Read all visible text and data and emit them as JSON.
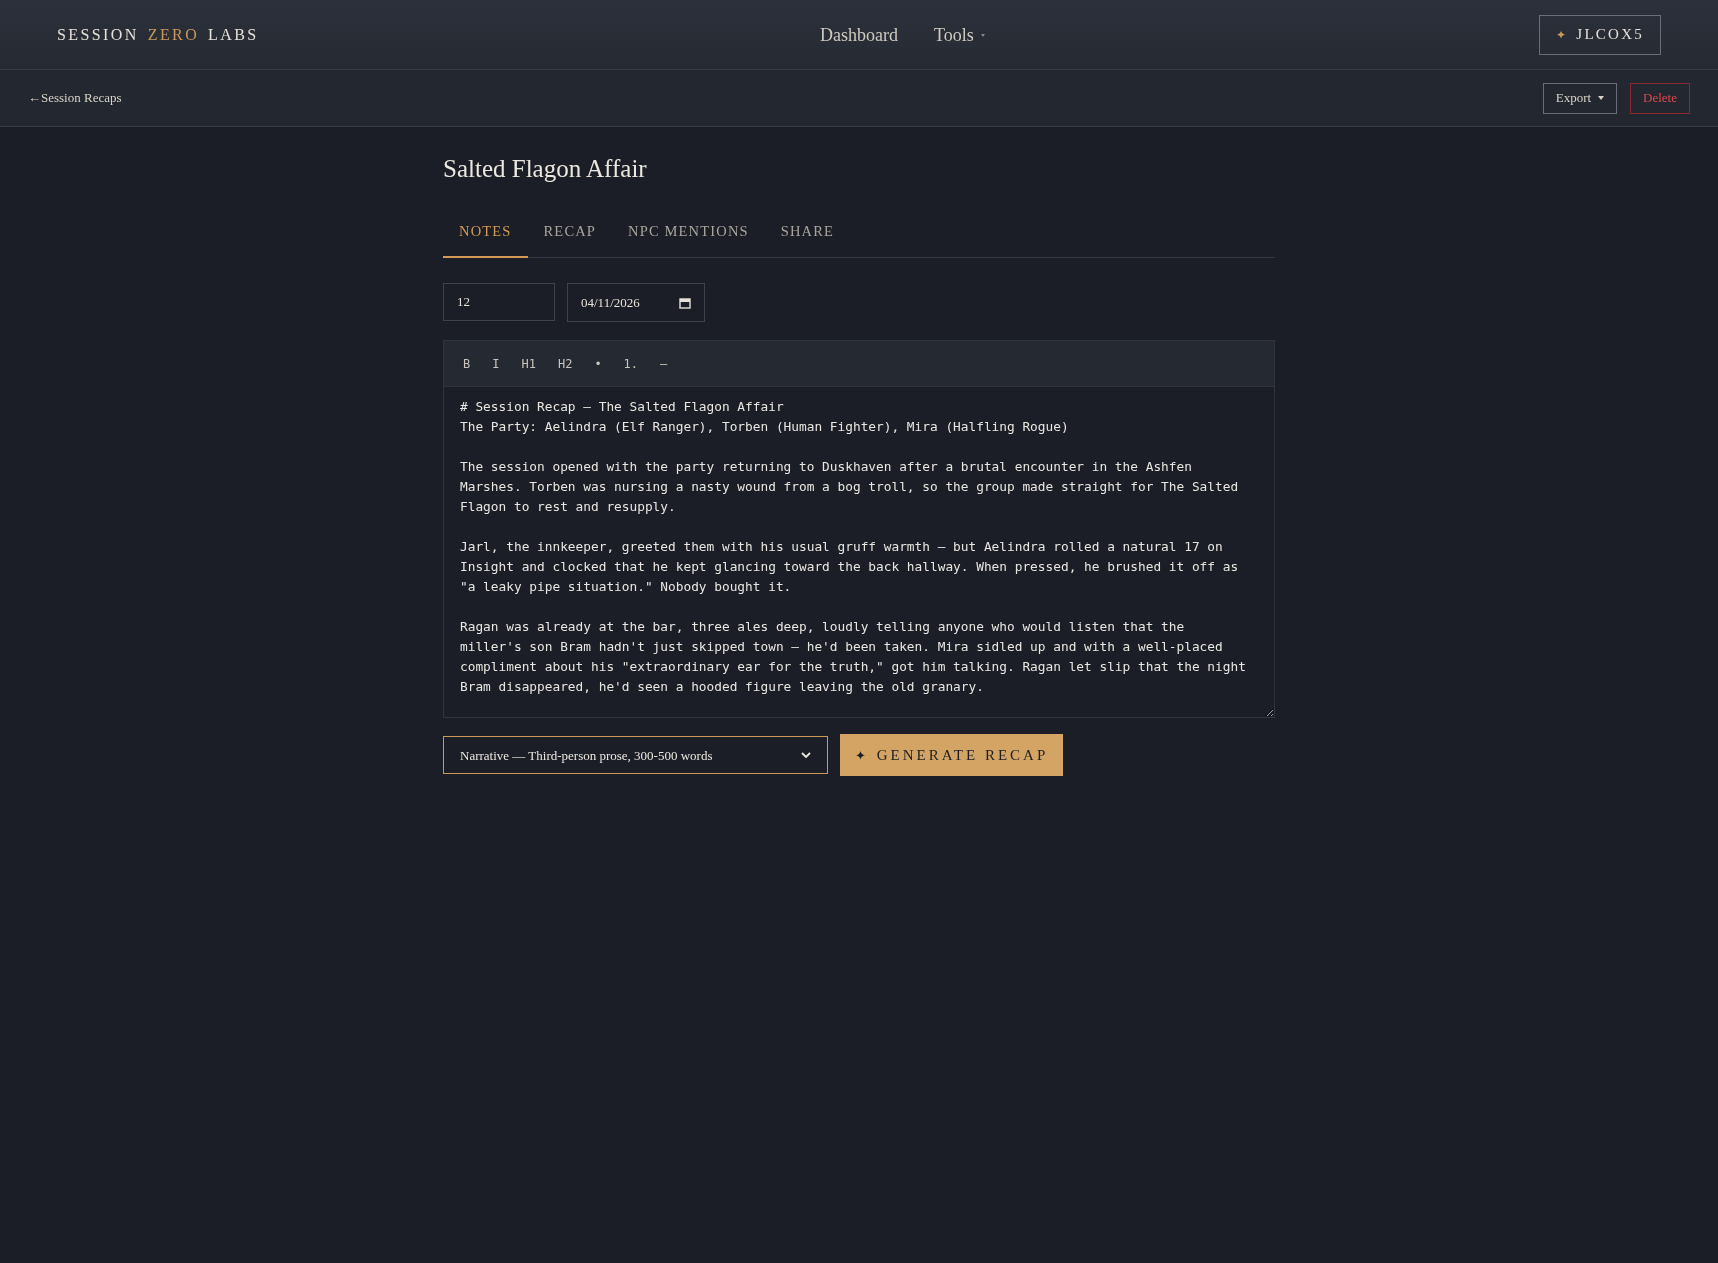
{
  "brand": {
    "parts": [
      {
        "text": "SESSION",
        "accent": false
      },
      {
        "text": "ZERO",
        "accent": true
      },
      {
        "text": "LABS",
        "accent": false
      }
    ]
  },
  "nav": [
    {
      "label": "Dashboard",
      "dropdown": false
    },
    {
      "label": "Tools",
      "dropdown": true
    }
  ],
  "user_button": {
    "icon": "✦",
    "label": "JLCOX5"
  },
  "back_link": {
    "arrow": "←",
    "label": "Session Recaps"
  },
  "actions": [
    {
      "label": "Export",
      "kind": "dropdown"
    },
    {
      "label": "Delete",
      "kind": "danger"
    }
  ],
  "title": "Salted Flagon Affair",
  "tabs": [
    {
      "label": "NOTES",
      "selected": true
    },
    {
      "label": "RECAP",
      "selected": false
    },
    {
      "label": "NPC MENTIONS",
      "selected": false
    },
    {
      "label": "SHARE",
      "selected": false
    }
  ],
  "session_number": "12",
  "session_date": "04/11/2026",
  "toolbar": [
    "B",
    "I",
    "H1",
    "H2",
    "•",
    "1.",
    "—"
  ],
  "notes": "# Session Recap — The Salted Flagon Affair\nThe Party: Aelindra (Elf Ranger), Torben (Human Fighter), Mira (Halfling Rogue)\n\nThe session opened with the party returning to Duskhaven after a brutal encounter in the Ashfen Marshes. Torben was nursing a nasty wound from a bog troll, so the group made straight for The Salted Flagon to rest and resupply.\n\nJarl, the innkeeper, greeted them with his usual gruff warmth — but Aelindra rolled a natural 17 on Insight and clocked that he kept glancing toward the back hallway. When pressed, he brushed it off as \"a leaky pipe situation.\" Nobody bought it.\n\nRagan was already at the bar, three ales deep, loudly telling anyone who would listen that the miller's son Bram hadn't just skipped town — he'd been taken. Mira sidled up and with a well-placed compliment about his \"extraordinary ear for the truth,\" got him talking. Ragan let slip that the night Bram disappeared, he'd seen a hooded figure leaving the old granary.",
  "style_select": "Narrative — Third-person prose, 300-500 words",
  "generate_button": {
    "icon": "✦",
    "label": "GENERATE RECAP"
  }
}
